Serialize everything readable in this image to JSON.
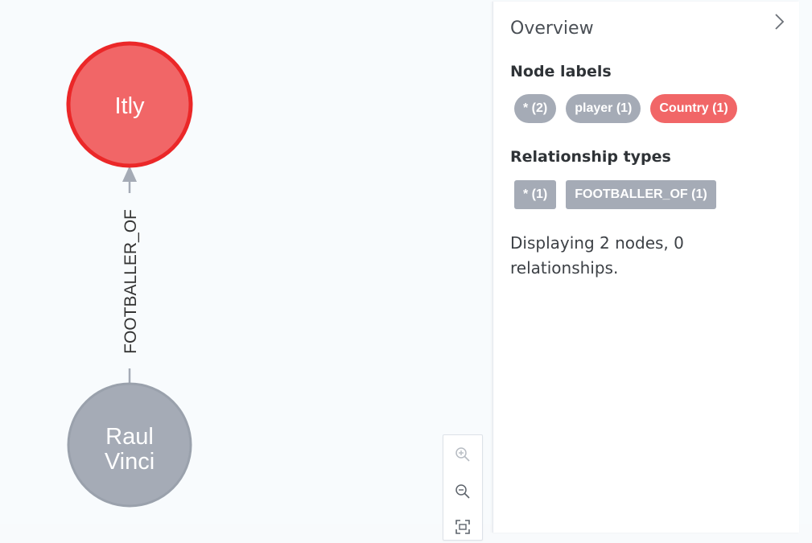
{
  "graph": {
    "nodes": [
      {
        "id": "itly",
        "caption_lines": [
          "Itly"
        ],
        "fill": "#f16667",
        "stroke": "#eb2728"
      },
      {
        "id": "raul",
        "caption_lines": [
          "Raul",
          "Vinci"
        ],
        "fill": "#a5abb6",
        "stroke": "#9aa1ac"
      }
    ],
    "relationship": {
      "label": "FOOTBALLER_OF",
      "color": "#a5abb6"
    }
  },
  "zoom": {
    "zoom_in_icon": "zoom-in-icon",
    "zoom_out_icon": "zoom-out-icon",
    "fit_icon": "fit-to-screen-icon"
  },
  "panel": {
    "title": "Overview",
    "collapse_icon": "chevron-right-icon",
    "node_labels_heading": "Node labels",
    "node_labels": [
      {
        "label": "* (2)",
        "color": "#a5abb6"
      },
      {
        "label": "player (1)",
        "color": "#a5abb6"
      },
      {
        "label": "Country (1)",
        "color": "#f16667"
      }
    ],
    "relationship_types_heading": "Relationship types",
    "relationship_types": [
      {
        "label": "* (1)",
        "color": "#a5abb6"
      },
      {
        "label": "FOOTBALLER_OF (1)",
        "color": "#a5abb6"
      }
    ],
    "summary": "Displaying 2 nodes, 0 relationships."
  }
}
